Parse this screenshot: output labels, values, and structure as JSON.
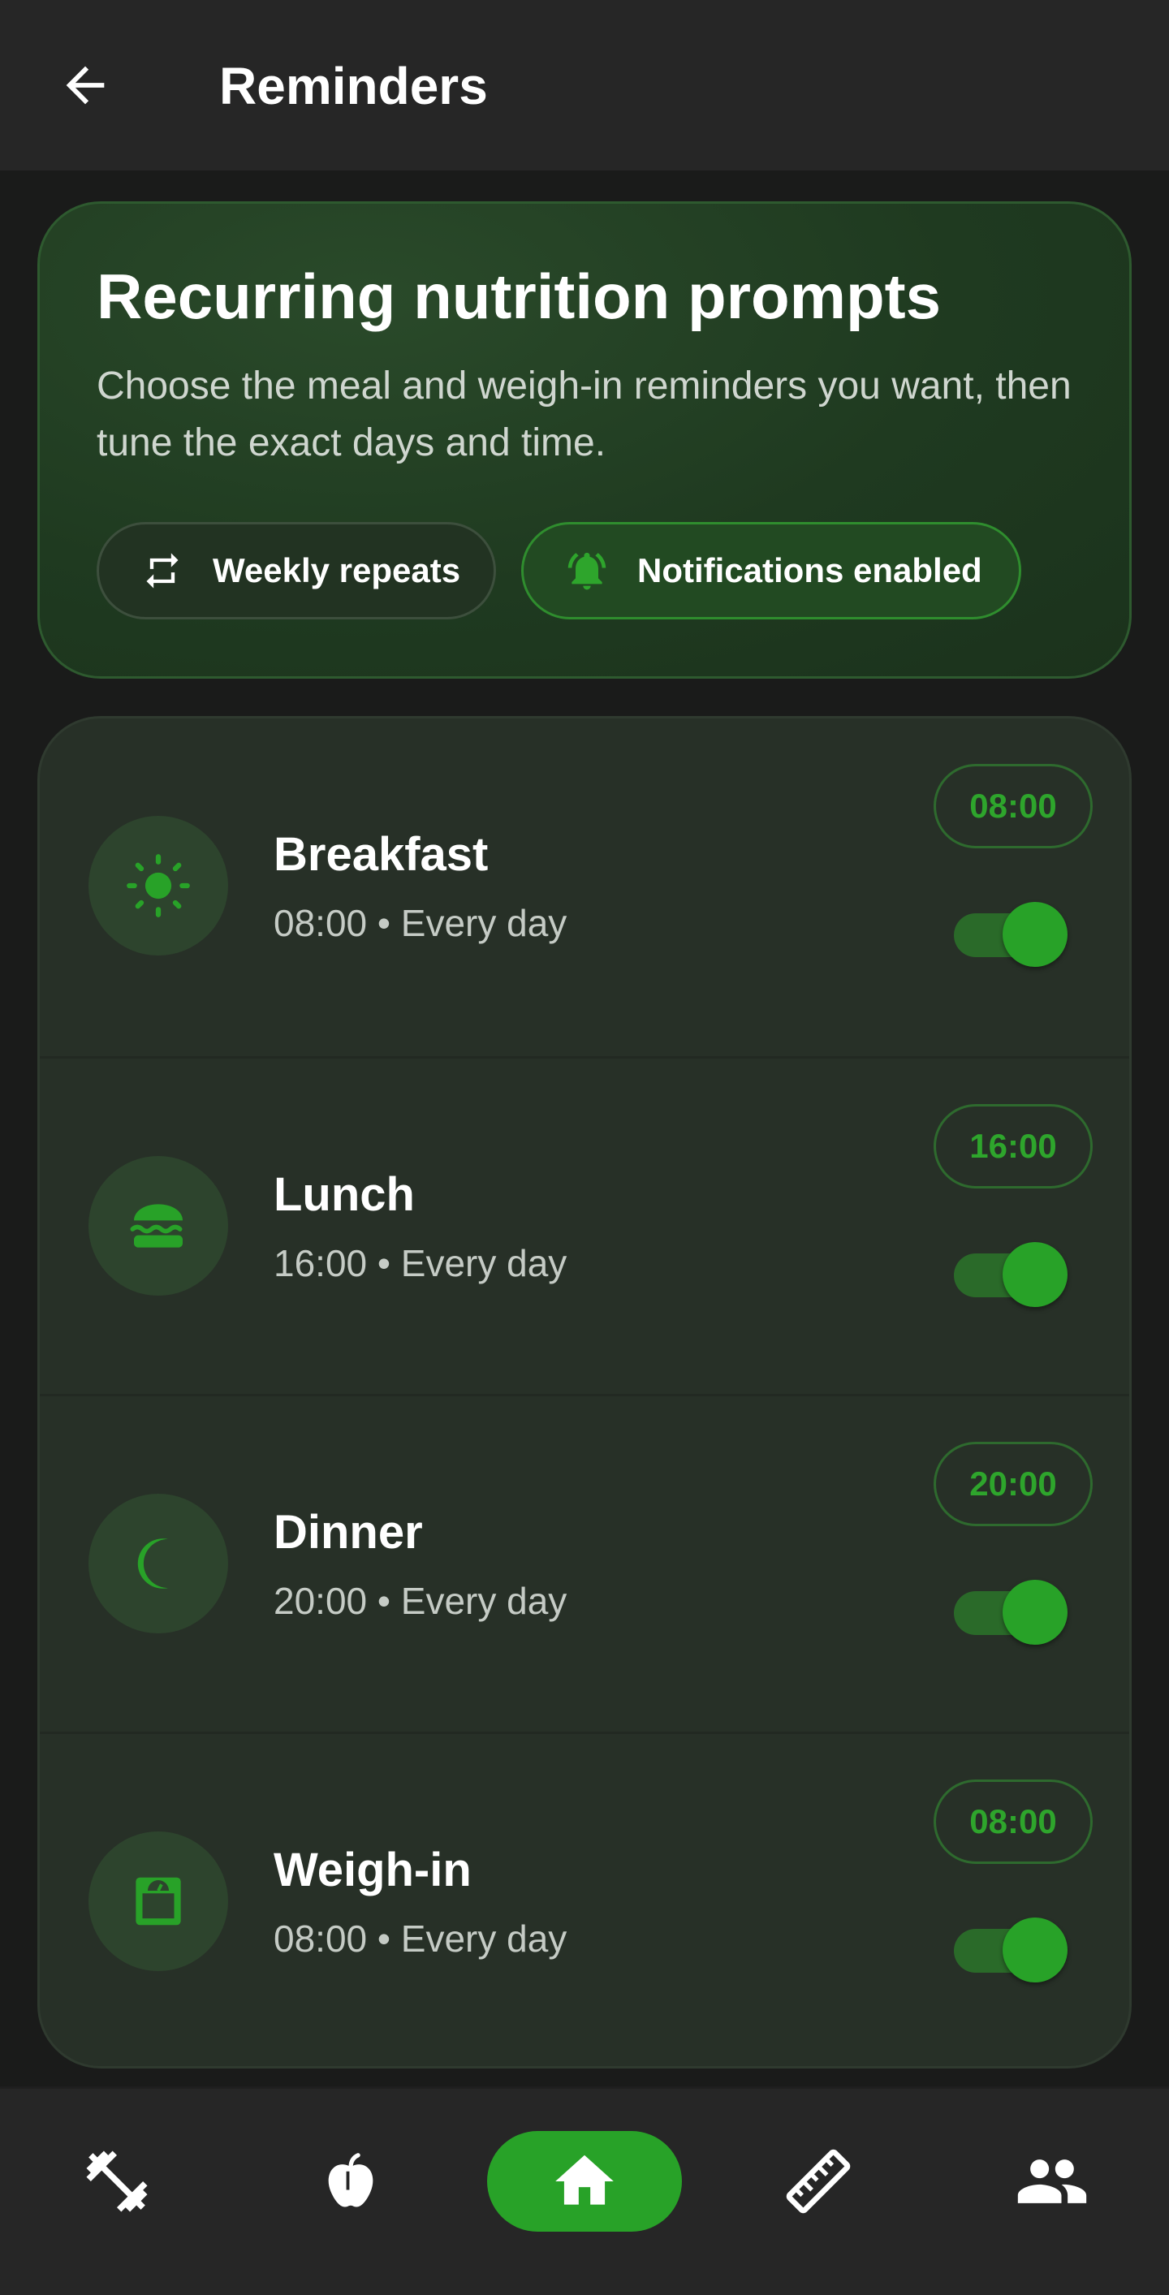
{
  "header": {
    "title": "Reminders",
    "back_icon": "arrow-left-icon"
  },
  "hero": {
    "title": "Recurring nutrition prompts",
    "description": "Choose the meal and weigh-in reminders you want, then tune the exact days and time.",
    "chips": [
      {
        "label": "Weekly repeats",
        "icon": "repeat-icon"
      },
      {
        "label": "Notifications enabled",
        "icon": "bell-ring-icon"
      }
    ]
  },
  "reminders": [
    {
      "title": "Breakfast",
      "subtitle": "08:00 • Every day",
      "time": "08:00",
      "enabled": true,
      "icon": "sun-icon"
    },
    {
      "title": "Lunch",
      "subtitle": "16:00 • Every day",
      "time": "16:00",
      "enabled": true,
      "icon": "burger-icon"
    },
    {
      "title": "Dinner",
      "subtitle": "20:00 • Every day",
      "time": "20:00",
      "enabled": true,
      "icon": "moon-icon"
    },
    {
      "title": "Weigh-in",
      "subtitle": "08:00 • Every day",
      "time": "08:00",
      "enabled": true,
      "icon": "scale-icon"
    }
  ],
  "bottom_nav": [
    {
      "id": "workouts",
      "icon": "dumbbell-icon",
      "active": false
    },
    {
      "id": "nutrition",
      "icon": "apple-icon",
      "active": false
    },
    {
      "id": "home",
      "icon": "home-icon",
      "active": true
    },
    {
      "id": "measurements",
      "icon": "ruler-icon",
      "active": false
    },
    {
      "id": "community",
      "icon": "people-icon",
      "active": false
    }
  ],
  "colors": {
    "accent": "#28a228",
    "background": "#1a1b1a",
    "surface": "#262626",
    "card": "#273027"
  }
}
